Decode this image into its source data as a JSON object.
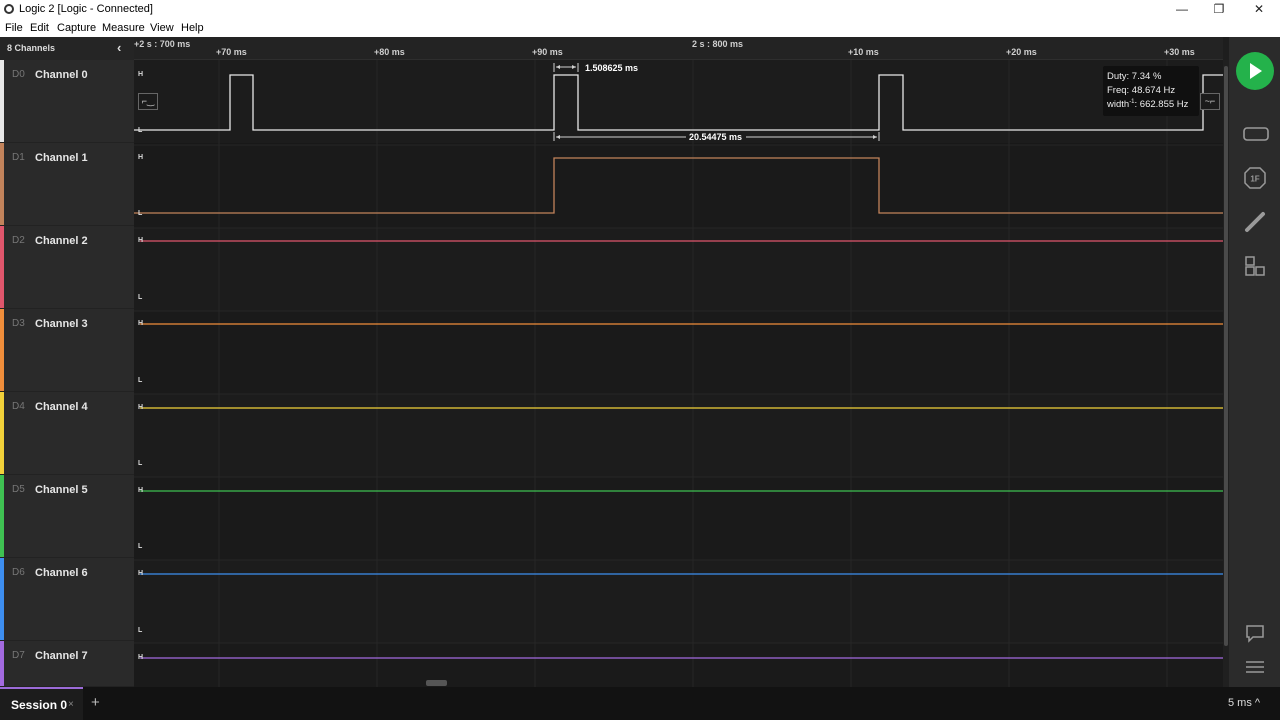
{
  "window": {
    "title": "Logic 2 [Logic - Connected]",
    "minimize": "—",
    "maximize": "❐",
    "close": "✕"
  },
  "menu": [
    "File",
    "Edit",
    "Capture",
    "Measure",
    "View",
    "Help"
  ],
  "channel_panel": {
    "header": "8 Channels",
    "collapse_icon": "chevron-left-icon",
    "channels": [
      {
        "id": "D0",
        "name": "Channel 0",
        "color": "#e8e8e8"
      },
      {
        "id": "D1",
        "name": "Channel 1",
        "color": "#c2835b"
      },
      {
        "id": "D2",
        "name": "Channel 2",
        "color": "#e0566c"
      },
      {
        "id": "D3",
        "name": "Channel 3",
        "color": "#f08e3b"
      },
      {
        "id": "D4",
        "name": "Channel 4",
        "color": "#f2d13a"
      },
      {
        "id": "D5",
        "name": "Channel 5",
        "color": "#3fc152"
      },
      {
        "id": "D6",
        "name": "Channel 6",
        "color": "#3d8ef0"
      },
      {
        "id": "D7",
        "name": "Channel 7",
        "color": "#a36ae0"
      }
    ]
  },
  "ruler": {
    "left_label": "+2 s : 700 ms",
    "center_label": "2 s : 800 ms",
    "ticks": [
      "+70 ms",
      "+80 ms",
      "+90 ms",
      "+10 ms",
      "+20 ms",
      "+30 ms"
    ]
  },
  "levels": {
    "high": "H",
    "low": "L"
  },
  "measurements": {
    "pulse_width": "1.508625 ms",
    "period": "20.54475 ms"
  },
  "tooltip": {
    "duty": "Duty: 7.34 %",
    "freq": "Freq: 48.674 Hz",
    "width_prefix": "width",
    "width_sup": "-1",
    "width_value": ": 662.855 Hz"
  },
  "right_toolbar": {
    "play_icon": "play-icon",
    "icons": [
      "device-icon",
      "analyzer-icon",
      "measure-icon",
      "extensions-icon",
      "comment-icon",
      "menu-icon"
    ]
  },
  "bottom": {
    "session": "Session 0",
    "session_close": "×",
    "add": "+",
    "zoom": "5 ms ^"
  }
}
